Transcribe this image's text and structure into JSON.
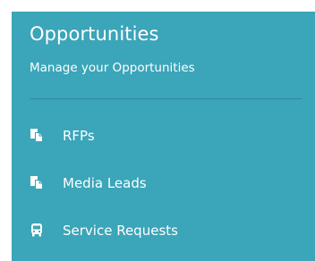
{
  "header": {
    "title": "Opportunities",
    "subtitle": "Manage your Opportunities"
  },
  "nav": {
    "items": [
      {
        "label": "RFPs",
        "icon": "documents-icon"
      },
      {
        "label": "Media Leads",
        "icon": "documents-icon"
      },
      {
        "label": "Service Requests",
        "icon": "bus-icon"
      }
    ]
  },
  "colors": {
    "panel_bg": "#3ba5b9",
    "text": "#ffffff",
    "divider": "#2c8a9c"
  }
}
